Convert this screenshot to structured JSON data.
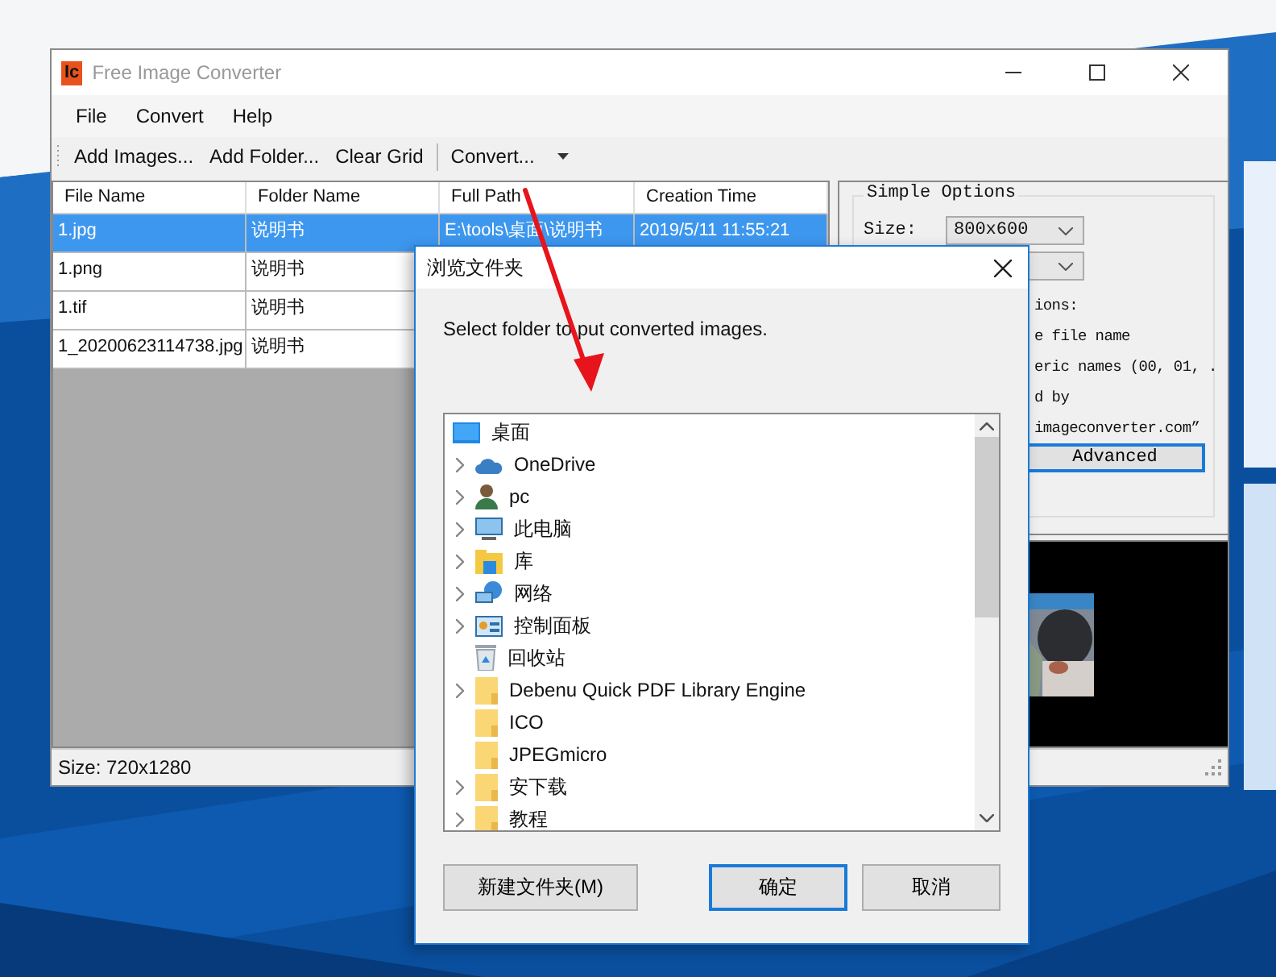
{
  "window": {
    "title": "Free Image Converter",
    "logo": "Ic"
  },
  "menu": [
    "File",
    "Convert",
    "Help"
  ],
  "toolbar": [
    {
      "label": "Add Images...",
      "dropdown": false
    },
    {
      "label": "Add Folder...",
      "dropdown": false
    },
    {
      "label": "Clear Grid",
      "dropdown": false
    },
    {
      "label": "Convert...",
      "dropdown": true
    }
  ],
  "grid": {
    "columns": [
      "File Name",
      "Folder Name",
      "Full Path",
      "Creation Time"
    ],
    "rows": [
      {
        "cells": [
          "1.jpg",
          "说明书",
          "E:\\tools\\桌面\\说明书",
          "2019/5/11 11:55:21"
        ],
        "selected": true
      },
      {
        "cells": [
          "1.png",
          "说明书"
        ],
        "selected": false
      },
      {
        "cells": [
          "1.tif",
          "说明书"
        ],
        "selected": false
      },
      {
        "cells": [
          "1_20200623114738.jpg",
          "说明书"
        ],
        "selected": false
      }
    ]
  },
  "options": {
    "title": "Simple Options",
    "size_label": "Size:",
    "size_value": "800x600",
    "lines": [
      "ions:",
      "e file name",
      "eric names (00, 01, .",
      "d by",
      "imageconverter.com”"
    ],
    "advanced_button": "Advanced"
  },
  "status_bar": "Size: 720x1280",
  "dialog": {
    "title": "浏览文件夹",
    "prompt": "Select folder to put converted images.",
    "tree": [
      {
        "label": "桌面",
        "kind": "desktop",
        "expandable": false,
        "children": [
          {
            "label": "OneDrive",
            "kind": "cloud",
            "expandable": true
          },
          {
            "label": "pc",
            "kind": "user",
            "expandable": true
          },
          {
            "label": "此电脑",
            "kind": "computer",
            "expandable": true
          },
          {
            "label": "库",
            "kind": "library",
            "expandable": true
          },
          {
            "label": "网络",
            "kind": "network",
            "expandable": true
          },
          {
            "label": "控制面板",
            "kind": "control-panel",
            "expandable": true
          },
          {
            "label": "回收站",
            "kind": "recycle",
            "expandable": false
          },
          {
            "label": "Debenu Quick PDF Library Engine",
            "kind": "folder",
            "expandable": true
          },
          {
            "label": "ICO",
            "kind": "folder",
            "expandable": false
          },
          {
            "label": "JPEGmicro",
            "kind": "folder",
            "expandable": false
          },
          {
            "label": "安下载",
            "kind": "folder",
            "expandable": true
          },
          {
            "label": "教程",
            "kind": "folder",
            "expandable": true
          }
        ]
      }
    ],
    "buttons": [
      {
        "label": "新建文件夹(M)",
        "default": false
      },
      {
        "label": "确定",
        "default": true
      },
      {
        "label": "取消",
        "default": false
      }
    ]
  }
}
